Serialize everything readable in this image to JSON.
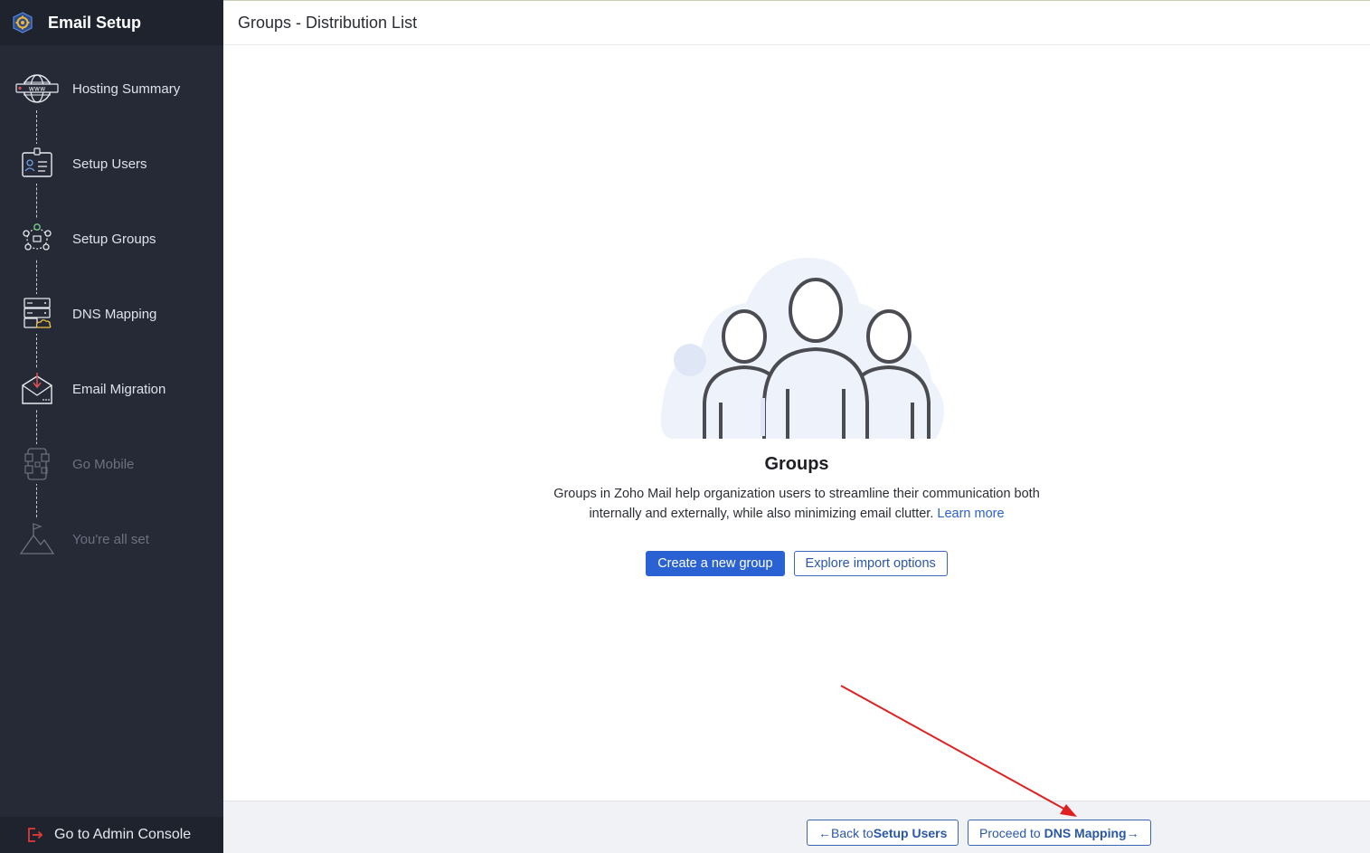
{
  "sidebar": {
    "title": "Email Setup",
    "logo_icon": "gear-settings-icon",
    "steps": [
      {
        "label": "Hosting Summary",
        "icon": "www-globe-icon",
        "enabled": true
      },
      {
        "label": "Setup Users",
        "icon": "user-card-icon",
        "enabled": true
      },
      {
        "label": "Setup Groups",
        "icon": "group-network-icon",
        "enabled": true
      },
      {
        "label": "DNS Mapping",
        "icon": "server-cloud-icon",
        "enabled": true
      },
      {
        "label": "Email Migration",
        "icon": "envelope-download-icon",
        "enabled": true
      },
      {
        "label": "Go Mobile",
        "icon": "mobile-qr-icon",
        "enabled": false
      },
      {
        "label": "You're all set",
        "icon": "mountain-flag-icon",
        "enabled": false
      }
    ],
    "footer_label": "Go to Admin Console",
    "footer_icon": "exit-icon"
  },
  "main": {
    "page_title": "Groups - Distribution List",
    "empty_state": {
      "illustration": "groups-people-illustration",
      "title": "Groups",
      "description": "Groups in Zoho Mail help organization users to streamline their communication both internally and externally, while also minimizing email clutter.",
      "learn_more": "Learn more",
      "primary_button": "Create a new group",
      "secondary_button": "Explore import options"
    }
  },
  "footer": {
    "back_prefix": "←Back to ",
    "back_target": "Setup Users",
    "next_prefix": "Proceed to ",
    "next_target": "DNS Mapping",
    "next_suffix": "→"
  },
  "colors": {
    "sidebar_bg": "#262a36",
    "primary": "#2a62d4",
    "annotation_arrow": "#e02020"
  }
}
